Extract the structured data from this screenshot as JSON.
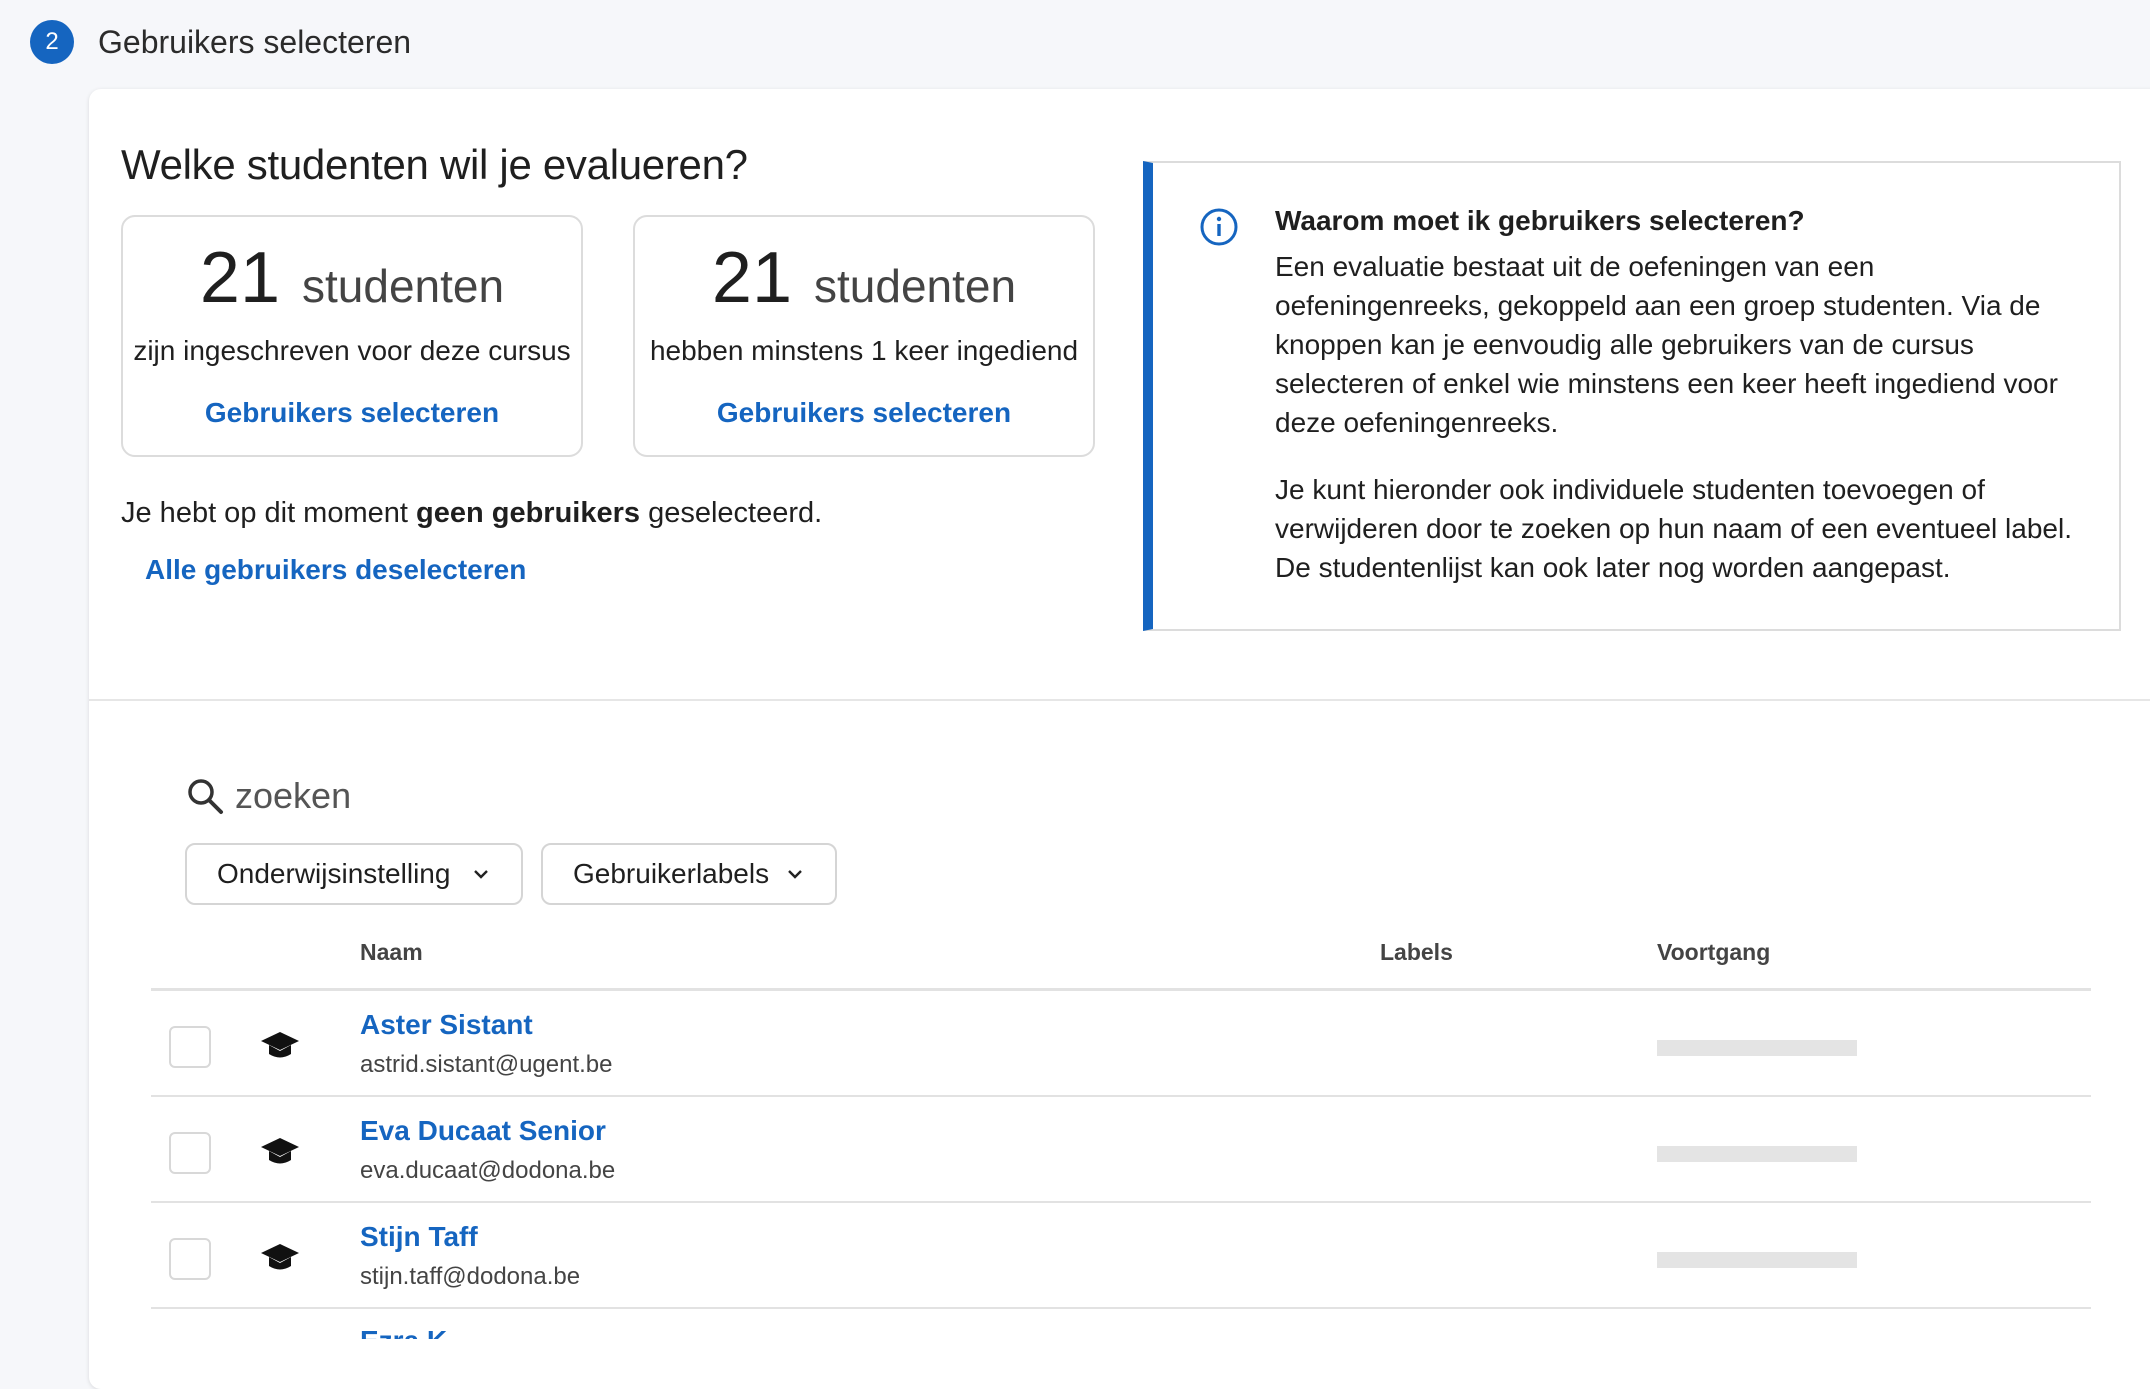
{
  "step": {
    "number": "2",
    "title": "Gebruikers selecteren"
  },
  "question": "Welke studenten wil je evalueren?",
  "stats": [
    {
      "count": "21",
      "unit": "studenten",
      "description": "zijn ingeschreven voor deze cursus",
      "link": "Gebruikers selecteren"
    },
    {
      "count": "21",
      "unit": "studenten",
      "description": "hebben minstens 1 keer ingediend",
      "link": "Gebruikers selecteren"
    }
  ],
  "selection": {
    "prefix": "Je hebt op dit moment ",
    "bold": "geen gebruikers",
    "suffix": " geselecteerd.",
    "deselect_link": "Alle gebruikers deselecteren"
  },
  "info": {
    "icon": "info-icon",
    "title": "Waarom moet ik gebruikers selecteren?",
    "paragraph1": "Een evaluatie bestaat uit de oefeningen van een oefeningenreeks, gekoppeld aan een groep studenten. Via de knoppen kan je eenvoudig alle gebruikers van de cursus selecteren of enkel wie minstens een keer heeft ingediend voor deze oefeningenreeks.",
    "paragraph2": "Je kunt hieronder ook individuele studenten toevoegen of verwijderen door te zoeken op hun naam of een eventueel label. De studentenlijst kan ook later nog worden aangepast."
  },
  "search": {
    "placeholder": "zoeken",
    "value": ""
  },
  "filters": [
    {
      "label": "Onderwijsinstelling"
    },
    {
      "label": "Gebruikerlabels"
    }
  ],
  "table": {
    "headers": {
      "name": "Naam",
      "labels": "Labels",
      "progress": "Voortgang"
    },
    "rows": [
      {
        "name": "Aster Sistant",
        "email": "astrid.sistant@ugent.be",
        "role_icon": "graduation-cap-icon",
        "progress": 0
      },
      {
        "name": "Eva Ducaat Senior",
        "email": "eva.ducaat@dodona.be",
        "role_icon": "graduation-cap-icon",
        "progress": 0
      },
      {
        "name": "Stijn Taff",
        "email": "stijn.taff@dodona.be",
        "role_icon": "graduation-cap-icon",
        "progress": 0
      }
    ],
    "partial_row_name": "Ezra K"
  },
  "colors": {
    "accent": "#1565c0",
    "progress_track": "#e4e4e4"
  }
}
